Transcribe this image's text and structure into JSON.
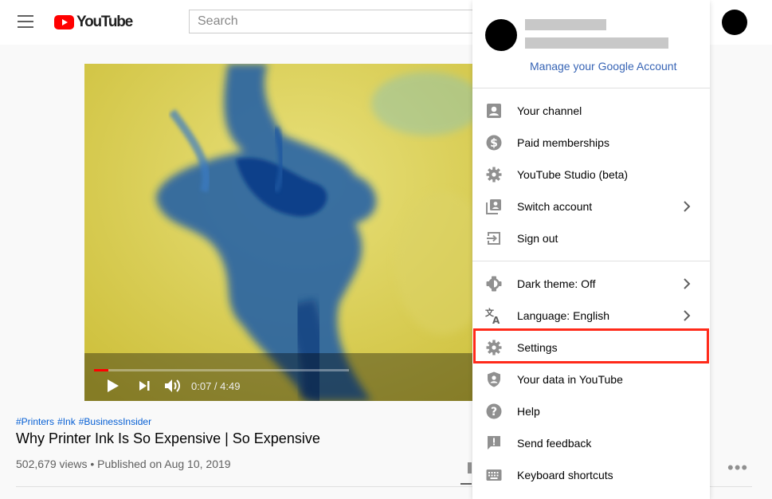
{
  "header": {
    "logo_text": "YouTube",
    "search_placeholder": "Search"
  },
  "player": {
    "time": "0:07 / 4:49",
    "progress_fraction": 0.025
  },
  "video": {
    "hashtags": [
      "#Printers",
      "#Ink",
      "#BusinessInsider"
    ],
    "title": "Why Printer Ink Is So Expensive | So Expensive",
    "meta": "502,679 views • Published on Aug 10, 2019"
  },
  "account_menu": {
    "manage_link": "Manage your Google Account",
    "group1": [
      {
        "label": "Your channel",
        "icon": "account-box-icon"
      },
      {
        "label": "Paid memberships",
        "icon": "dollar-circle-icon"
      },
      {
        "label": "YouTube Studio (beta)",
        "icon": "gear-icon"
      },
      {
        "label": "Switch account",
        "icon": "switch-account-icon",
        "chevron": true
      },
      {
        "label": "Sign out",
        "icon": "sign-out-icon"
      }
    ],
    "group2": [
      {
        "label": "Dark theme: Off",
        "icon": "dark-theme-icon",
        "chevron": true
      },
      {
        "label": "Language: English",
        "icon": "translate-icon",
        "chevron": true
      },
      {
        "label": "Settings",
        "icon": "gear-icon",
        "highlighted": true
      },
      {
        "label": "Your data in YouTube",
        "icon": "shield-person-icon"
      },
      {
        "label": "Help",
        "icon": "help-icon"
      },
      {
        "label": "Send feedback",
        "icon": "feedback-icon"
      },
      {
        "label": "Keyboard shortcuts",
        "icon": "keyboard-icon"
      }
    ]
  },
  "colors": {
    "youtube_red": "#ff0000",
    "link_blue": "#065fd4",
    "highlight_red": "#ff2a1a"
  }
}
